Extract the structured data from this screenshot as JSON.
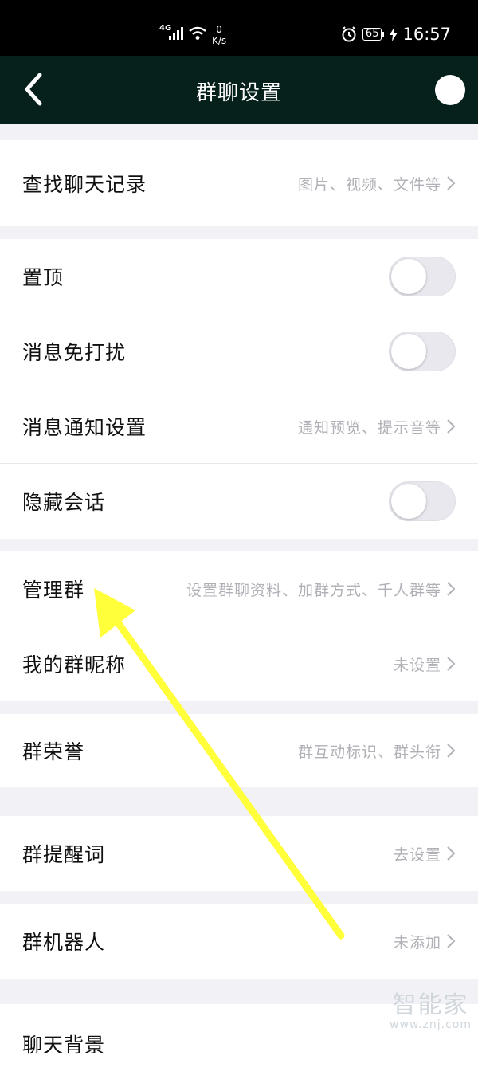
{
  "status_bar": {
    "network": "4G",
    "speed_value": "0",
    "speed_unit": "K/s",
    "battery": "65",
    "time": "16:57"
  },
  "header": {
    "title": "群聊设置"
  },
  "rows": {
    "search_history": {
      "label": "查找聊天记录",
      "hint": "图片、视频、文件等"
    },
    "pin": {
      "label": "置顶",
      "toggle_on": false
    },
    "do_not_disturb": {
      "label": "消息免打扰",
      "toggle_on": false
    },
    "notification_settings": {
      "label": "消息通知设置",
      "hint": "通知预览、提示音等"
    },
    "hide_chat": {
      "label": "隐藏会话",
      "toggle_on": false
    },
    "manage_group": {
      "label": "管理群",
      "hint": "设置群聊资料、加群方式、千人群等"
    },
    "my_nickname": {
      "label": "我的群昵称",
      "hint": "未设置"
    },
    "group_honor": {
      "label": "群荣誉",
      "hint": "群互动标识、群头衔"
    },
    "group_reminder": {
      "label": "群提醒词",
      "hint": "去设置"
    },
    "group_robot": {
      "label": "群机器人",
      "hint": "未添加"
    },
    "chat_background": {
      "label": "聊天背景"
    }
  },
  "chevron": "›",
  "watermark": {
    "text": "智能家",
    "url": "www.znj.com"
  },
  "colors": {
    "header_bg": "#06201b",
    "arrow": "#ffff3a",
    "hint": "#b0b0b7"
  }
}
